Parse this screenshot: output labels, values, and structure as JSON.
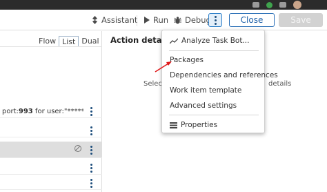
{
  "toolbar": {
    "assistant_label": "Assistant",
    "run_label": "Run",
    "debug_label": "Debug",
    "close_label": "Close",
    "save_label": "Save"
  },
  "left_panel": {
    "view_tabs": [
      "Flow",
      "List",
      "Dual"
    ],
    "active_view_tab": "List",
    "rows": [
      {
        "text_before": "port:",
        "bold": "993",
        "text_after": " for user:\"******",
        "selected": false
      },
      {
        "text_before": "",
        "bold": "",
        "text_after": "",
        "selected": false
      },
      {
        "text_before": "",
        "bold": "",
        "text_after": "",
        "selected": true
      },
      {
        "text_before": "",
        "bold": "",
        "text_after": "",
        "selected": false
      },
      {
        "text_before": "",
        "bold": "",
        "text_after": "",
        "selected": false
      }
    ]
  },
  "action_details": {
    "title": "Action details",
    "hint_left": "Select",
    "hint_right": "details"
  },
  "menu": {
    "items": {
      "analyze": "Analyze Task Bot...",
      "packages": "Packages",
      "dependencies": "Dependencies and references",
      "work_item": "Work item template",
      "advanced": "Advanced settings",
      "properties": "Properties"
    }
  },
  "colors": {
    "accent": "#2a6fb7",
    "annotation_arrow": "#e0191b"
  },
  "icons": [
    "assistant-icon",
    "play-icon",
    "bug-icon",
    "kebab-icon",
    "chart-icon",
    "properties-icon",
    "disabled-icon"
  ]
}
